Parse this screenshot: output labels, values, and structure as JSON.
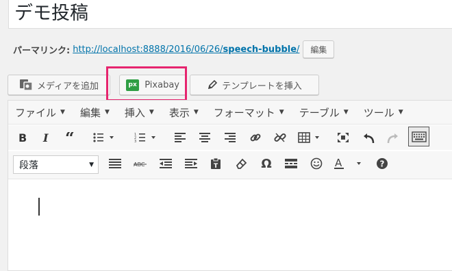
{
  "title": "デモ投稿",
  "permalink": {
    "label": "パーマリンク:",
    "url_base": "http://localhost:8888/2016/06/26/",
    "slug": "speech-bubble",
    "trailing": "/",
    "edit_label": "編集"
  },
  "media_buttons": {
    "add_media": "メディアを追加",
    "pixabay": "Pixabay",
    "pixabay_icon_text": "px",
    "template": "テンプレートを挿入"
  },
  "highlight_color": "#e6246e",
  "menubar": [
    "ファイル",
    "編集",
    "挿入",
    "表示",
    "フォーマット",
    "テーブル",
    "ツール"
  ],
  "toolbar1_icons": [
    "bold-icon",
    "italic-icon",
    "blockquote-icon",
    "bullet-list-icon",
    "numbered-list-icon",
    "align-left-icon",
    "align-center-icon",
    "align-right-icon",
    "link-icon",
    "unlink-icon",
    "table-icon",
    "fullscreen-icon",
    "undo-icon",
    "redo-icon",
    "keyboard-icon"
  ],
  "toolbar2": {
    "format_select": "段落",
    "icons": [
      "horizontal-rule-icon",
      "strikethrough-icon",
      "outdent-icon",
      "indent-icon",
      "paste-text-icon",
      "eraser-icon",
      "omega-icon",
      "read-more-icon",
      "emoticon-icon",
      "text-color-icon",
      "help-icon"
    ],
    "strikethrough_text": "ABC",
    "text_color_glyph": "A",
    "omega_glyph": "Ω",
    "help_glyph": "?"
  }
}
